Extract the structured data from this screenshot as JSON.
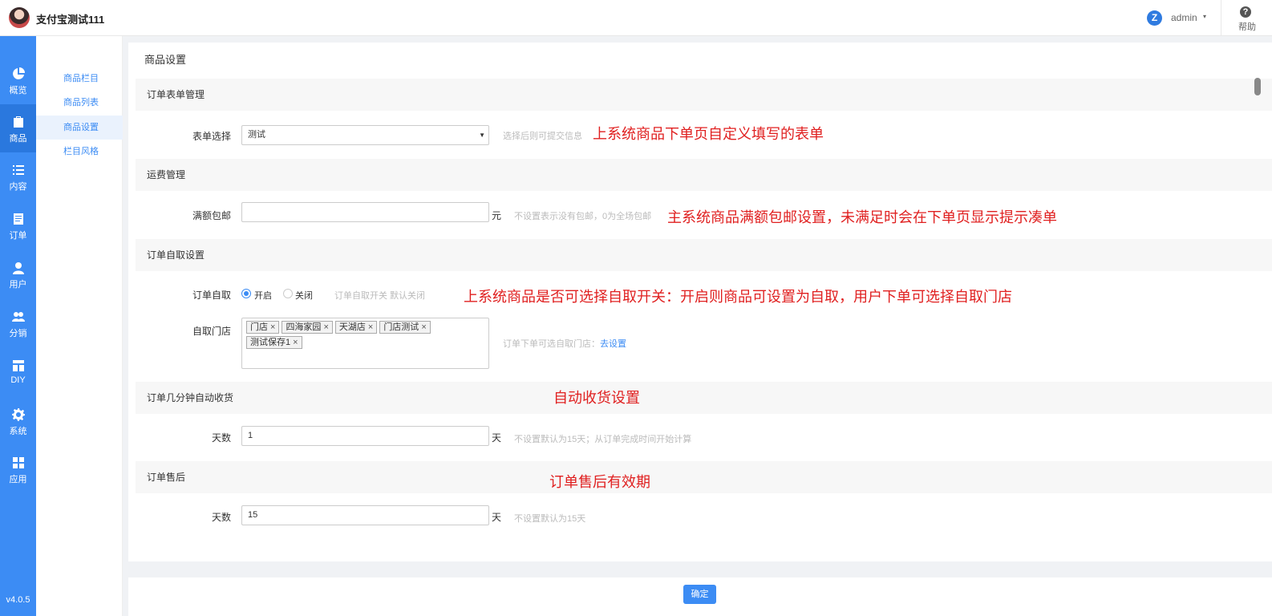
{
  "header": {
    "app_title": "支付宝测试111",
    "user_name": "admin",
    "user_caret": "▾",
    "help_icon": "?",
    "help_label": "帮助",
    "user_logo_text": "Z"
  },
  "nav": {
    "items": [
      {
        "label": "概览",
        "icon": "pie-chart-icon"
      },
      {
        "label": "商品",
        "icon": "bag-icon"
      },
      {
        "label": "内容",
        "icon": "list-icon"
      },
      {
        "label": "订单",
        "icon": "order-icon"
      },
      {
        "label": "用户",
        "icon": "user-icon"
      },
      {
        "label": "分销",
        "icon": "group-icon"
      },
      {
        "label": "DIY",
        "icon": "layout-icon"
      },
      {
        "label": "系统",
        "icon": "gear-icon"
      },
      {
        "label": "应用",
        "icon": "grid-icon"
      }
    ],
    "active_color": "#2a78de",
    "version": "v4.0.5"
  },
  "subnav": {
    "items": [
      "商品栏目",
      "商品列表",
      "商品设置",
      "栏目风格"
    ],
    "active": "商品设置"
  },
  "page": {
    "title": "商品设置",
    "sections": {
      "form_mgmt": "订单表单管理",
      "freight": "运费管理",
      "pickup": "订单自取设置",
      "auto_receive": "订单几分钟自动收货",
      "after_sale": "订单售后"
    },
    "form_select": {
      "label": "表单选择",
      "value": "测试",
      "caret": "▼",
      "hint": "选择后则可提交信息"
    },
    "free_shipping": {
      "label": "满额包邮",
      "value": "",
      "unit": "元",
      "hint": "不设置表示没有包邮，0为全场包邮"
    },
    "pickup_switch": {
      "label": "订单自取",
      "options": [
        "开启",
        "关闭"
      ],
      "selected": "开启",
      "hint": "订单自取开关 默认关闭"
    },
    "pickup_stores": {
      "label": "自取门店",
      "tags": [
        "门店",
        "四海家园",
        "天湖店",
        "门店测试",
        "测试保存1"
      ],
      "remove_glyph": "×",
      "hint": "订单下单可选自取门店：",
      "link": "去设置"
    },
    "receive_days": {
      "label": "天数",
      "value": "1",
      "unit": "天",
      "hint": "不设置默认为15天；从订单完成时间开始计算"
    },
    "after_sale_days": {
      "label": "天数",
      "value": "15",
      "unit": "天",
      "hint": "不设置默认为15天"
    },
    "confirm_button": "确定"
  },
  "annotations": {
    "a1": "上系统商品下单页自定义填写的表单",
    "a2": "主系统商品满额包邮设置，未满足时会在下单页显示提示凑单",
    "a3": "上系统商品是否可选择自取开关：开启则商品可设置为自取，用户下单可选择自取门店",
    "a4": "自动收货设置",
    "a5": "订单售后有效期",
    "color": "#e02020"
  },
  "colors": {
    "primary": "#3c8cf4",
    "sidebar": "#3c8cf4"
  }
}
